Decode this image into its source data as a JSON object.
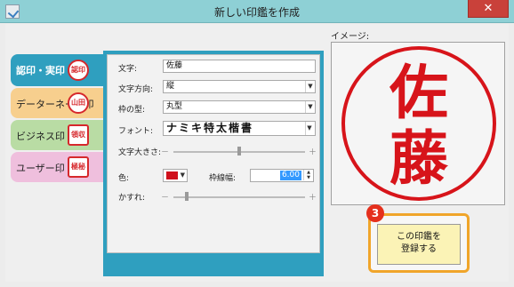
{
  "window": {
    "title": "新しい印鑑を作成",
    "close_label": "✕"
  },
  "tabs": [
    {
      "label": "認印・実印",
      "stamp": "認印"
    },
    {
      "label": "データーネーム印",
      "stamp": "山田"
    },
    {
      "label": "ビジネス印",
      "stamp": "領収"
    },
    {
      "label": "ユーザー印",
      "stamp": "極秘"
    }
  ],
  "form": {
    "text_label": "文字:",
    "text_value": "佐藤",
    "direction_label": "文字方向:",
    "direction_value": "縦",
    "frame_label": "枠の型:",
    "frame_value": "丸型",
    "font_label": "フォント:",
    "font_value": "ナミキ特太楷書",
    "size_label": "文字大きさ:",
    "color_label": "色:",
    "color_value": "#d0101c",
    "border_width_label": "枠線幅:",
    "border_width_value": "6.00",
    "blur_label": "かすれ:",
    "slider_minus": "－",
    "slider_plus": "＋",
    "size_level": 0.5,
    "blur_level": 0.1
  },
  "preview": {
    "label": "イメージ:",
    "chars": [
      "佐",
      "藤"
    ],
    "seal_color": "#d7141a"
  },
  "register": {
    "line1": "この印鑑を",
    "line2": "登録する",
    "step": "3"
  },
  "colors": {
    "accent": "#2f9fbf",
    "titlebar": "#8ed0d5",
    "highlight": "#f0a52a",
    "badge": "#e5301d"
  }
}
